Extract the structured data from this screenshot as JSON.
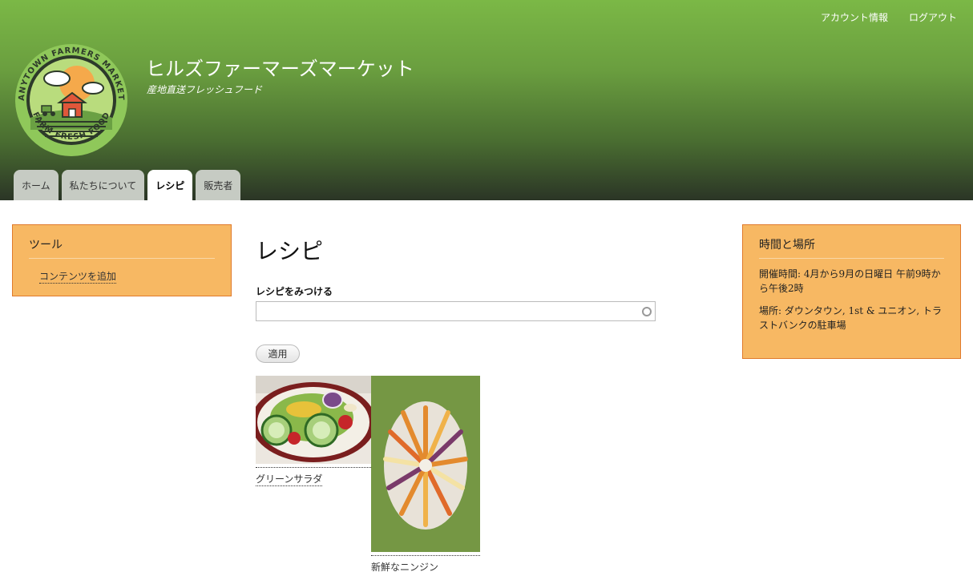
{
  "header": {
    "site_name": "ヒルズファーマーズマーケット",
    "slogan": "産地直送フレッシュフード",
    "logo_text_top": "ANYTOWN FARMERS MARKET",
    "logo_text_bottom": "FARM FRESH FOOD",
    "secondary_menu": [
      "アカウント情報",
      "ログアウト"
    ],
    "tabs": [
      {
        "label": "ホーム",
        "active": false
      },
      {
        "label": "私たちについて",
        "active": false
      },
      {
        "label": "レシピ",
        "active": true
      },
      {
        "label": "販売者",
        "active": false
      }
    ]
  },
  "sidebar_left": {
    "title": "ツール",
    "link": "コンテンツを追加"
  },
  "sidebar_right": {
    "title": "時間と場所",
    "hours": "開催時間: 4月から9月の日曜日 午前9時から午後2時",
    "location": "場所: ダウンタウン, 1st & ユニオン, トラストバンクの駐車場"
  },
  "main": {
    "title": "レシピ",
    "search_label": "レシピをみつける",
    "search_value": "",
    "apply_label": "適用",
    "recipes": [
      {
        "title": "グリーンサラダ"
      },
      {
        "title": "新鮮なニンジン"
      }
    ]
  },
  "colors": {
    "header_top": "#7bb846",
    "header_bottom": "#2b3526",
    "block_bg": "#f7b863",
    "block_border": "#e07a2c"
  }
}
